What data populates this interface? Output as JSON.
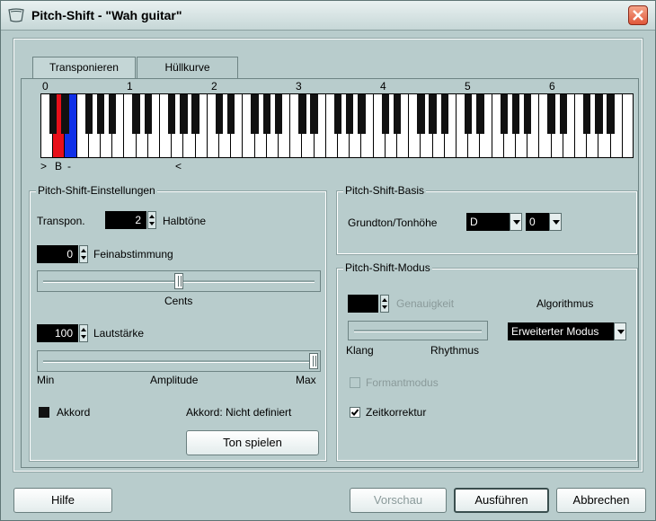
{
  "window": {
    "title": "Pitch-Shift - \"Wah guitar\""
  },
  "tabs": [
    {
      "label": "Transponieren",
      "active": true
    },
    {
      "label": "Hüllkurve",
      "active": false
    }
  ],
  "keyboard": {
    "octave_labels": [
      "0",
      "1",
      "2",
      "3",
      "4",
      "5",
      "6"
    ],
    "marker_left": ">",
    "marker_note": "B",
    "marker_dash": "-",
    "marker_right": "<",
    "red_key_color": "#e8101a",
    "blue_key_color": "#1030e8"
  },
  "settings": {
    "group_title": "Pitch-Shift-Einstellungen",
    "transpose_label": "Transpon.",
    "transpose_value": "2",
    "semitones_label": "Halbtöne",
    "finetune_value": "0",
    "finetune_label": "Feinabstimmung",
    "cents_label": "Cents",
    "cents_level": 0.5,
    "volume_value": "100",
    "volume_label": "Lautstärke",
    "amplitude_min": "Min",
    "amplitude_label": "Amplitude",
    "amplitude_max": "Max",
    "amplitude_level": 1.0,
    "chord_label": "Akkord",
    "chord_status": "Akkord: Nicht definiert",
    "play_button": "Ton spielen"
  },
  "basis": {
    "group_title": "Pitch-Shift-Basis",
    "root_label": "Grundton/Tonhöhe",
    "root_value": "D",
    "pitch_value": "0"
  },
  "mode": {
    "group_title": "Pitch-Shift-Modus",
    "accuracy_label": "Genauigkeit",
    "algorithm_label": "Algorithmus",
    "algorithm_value": "Erweiterter Modus",
    "sound_label": "Klang",
    "rhythm_label": "Rhythmus",
    "formant_label": "Formantmodus",
    "timecorrection_label": "Zeitkorrektur",
    "timecorrection_checked": true
  },
  "footer": {
    "help": "Hilfe",
    "preview": "Vorschau",
    "apply": "Ausführen",
    "cancel": "Abbrechen"
  }
}
